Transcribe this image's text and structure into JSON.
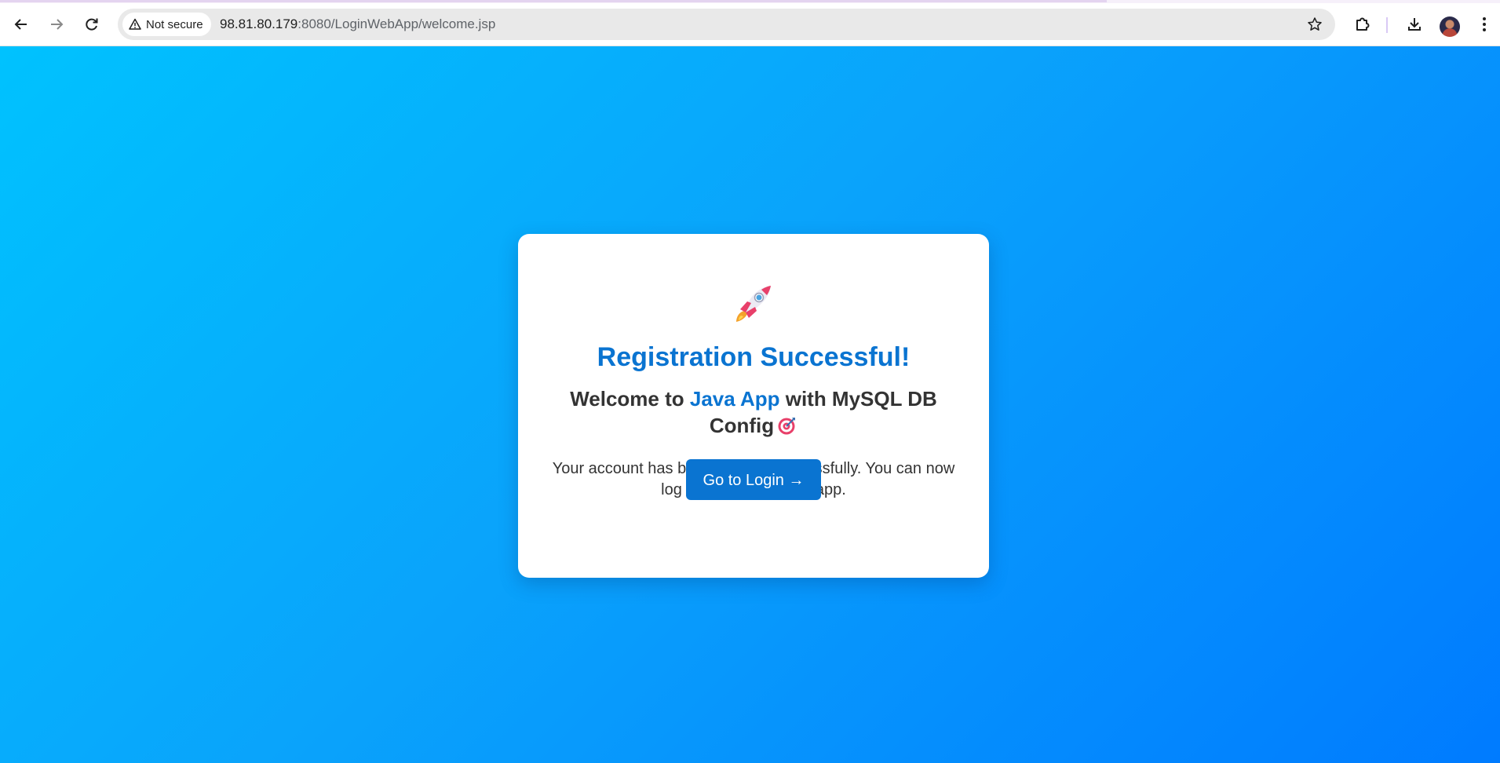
{
  "browser": {
    "security_chip": "Not secure",
    "url_host": "98.81.80.179",
    "url_rest": ":8080/LoginWebApp/welcome.jsp",
    "icons": {
      "back": "back-arrow-icon",
      "forward": "forward-arrow-icon",
      "reload": "reload-icon",
      "warning": "warning-triangle-icon",
      "star": "bookmark-star-icon",
      "extensions": "extensions-puzzle-icon",
      "downloads": "download-icon",
      "menu": "kebab-menu-icon"
    }
  },
  "page": {
    "background_gradient": [
      "#00c2fe",
      "#007bff"
    ],
    "accent_color": "#0a74d1",
    "card": {
      "emoji_top": "rocket",
      "title": "Registration Successful!",
      "subtitle_before": "Welcome to ",
      "subtitle_highlight": "Java App",
      "subtitle_after": " with MySQL DB Config",
      "subtitle_emoji": "target",
      "description": "Your account has been created successfully. You can now log in and explore the app.",
      "button_label": "Go to Login →"
    }
  }
}
